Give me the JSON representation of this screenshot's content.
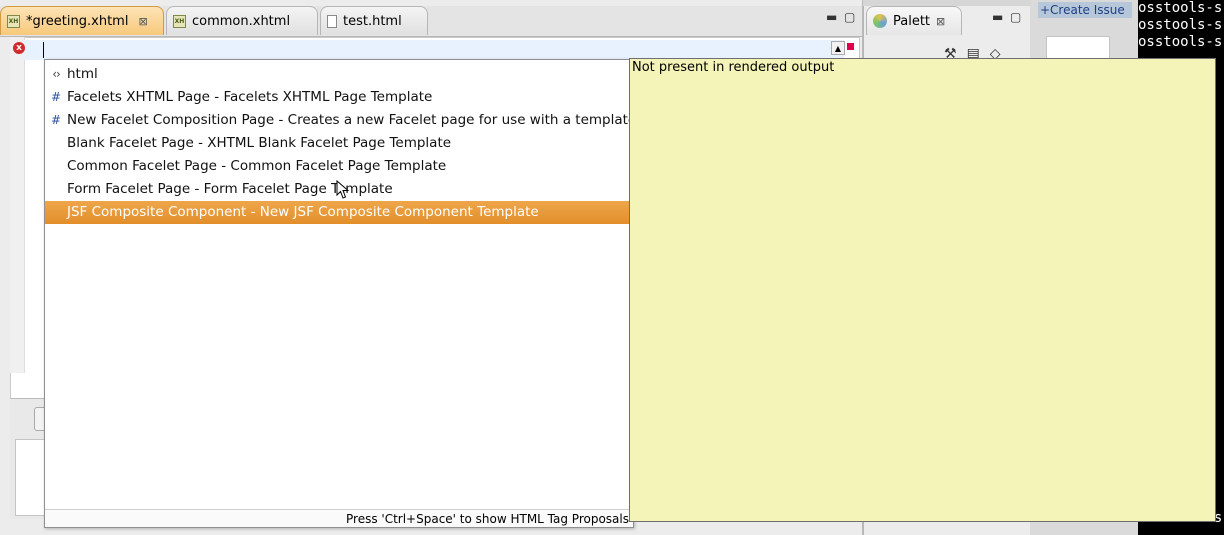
{
  "editor": {
    "tabs": [
      {
        "label": "*greeting.xhtml",
        "icon": "xhtml-file-icon",
        "active": true
      },
      {
        "label": "common.xhtml",
        "icon": "xhtml-file-icon",
        "active": false
      },
      {
        "label": "test.html",
        "icon": "html-file-icon",
        "active": false
      }
    ],
    "close_glyph": "⊠",
    "minimize_glyph": "▬",
    "maximize_glyph": "▢"
  },
  "palette": {
    "tab_label": "Palett",
    "close_glyph": "⊠",
    "tool_icons": [
      "hammer-icon",
      "clipboard-icon",
      "eraser-icon"
    ]
  },
  "background_right": {
    "create_issue_text": "+Create Issue",
    "terminal_lines": [
      "osstools-s",
      "osstools-s",
      "osstools-s",
      "",
      "",
      "",
      "",
      "",
      "",
      "",
      "",
      "",
      "",
      "",
      "",
      "",
      "",
      "",
      "",
      "",
      "",
      "",
      "",
      "",
      "",
      "",
      "",
      "",
      "",
      "",
      "osstools-s"
    ]
  },
  "content_assist": {
    "proposals": [
      {
        "icon": "tag-icon",
        "glyph": "‹›",
        "label": "html",
        "selected": false
      },
      {
        "icon": "template-icon",
        "glyph": "#",
        "label": "Facelets XHTML Page - Facelets XHTML Page Template",
        "selected": false
      },
      {
        "icon": "template-icon",
        "glyph": "#",
        "label": "New Facelet Composition Page - Creates a new Facelet page for use with a template.",
        "selected": false
      },
      {
        "icon": "",
        "glyph": "",
        "label": "Blank Facelet Page - XHTML Blank Facelet Page Template",
        "selected": false
      },
      {
        "icon": "",
        "glyph": "",
        "label": "Common Facelet Page - Common Facelet Page Template",
        "selected": false
      },
      {
        "icon": "",
        "glyph": "",
        "label": "Form Facelet Page - Form Facelet Page Template",
        "selected": false
      },
      {
        "icon": "",
        "glyph": "",
        "label": "JSF Composite Component - New JSF Composite Component Template",
        "selected": true
      }
    ],
    "status_text": "Press 'Ctrl+Space' to show HTML Tag Proposals"
  },
  "info_popup": {
    "text": "Not present in rendered output"
  },
  "colors": {
    "selection": "#e59632",
    "info_background": "#f5f4b8",
    "active_tab": "#f7c97c"
  }
}
